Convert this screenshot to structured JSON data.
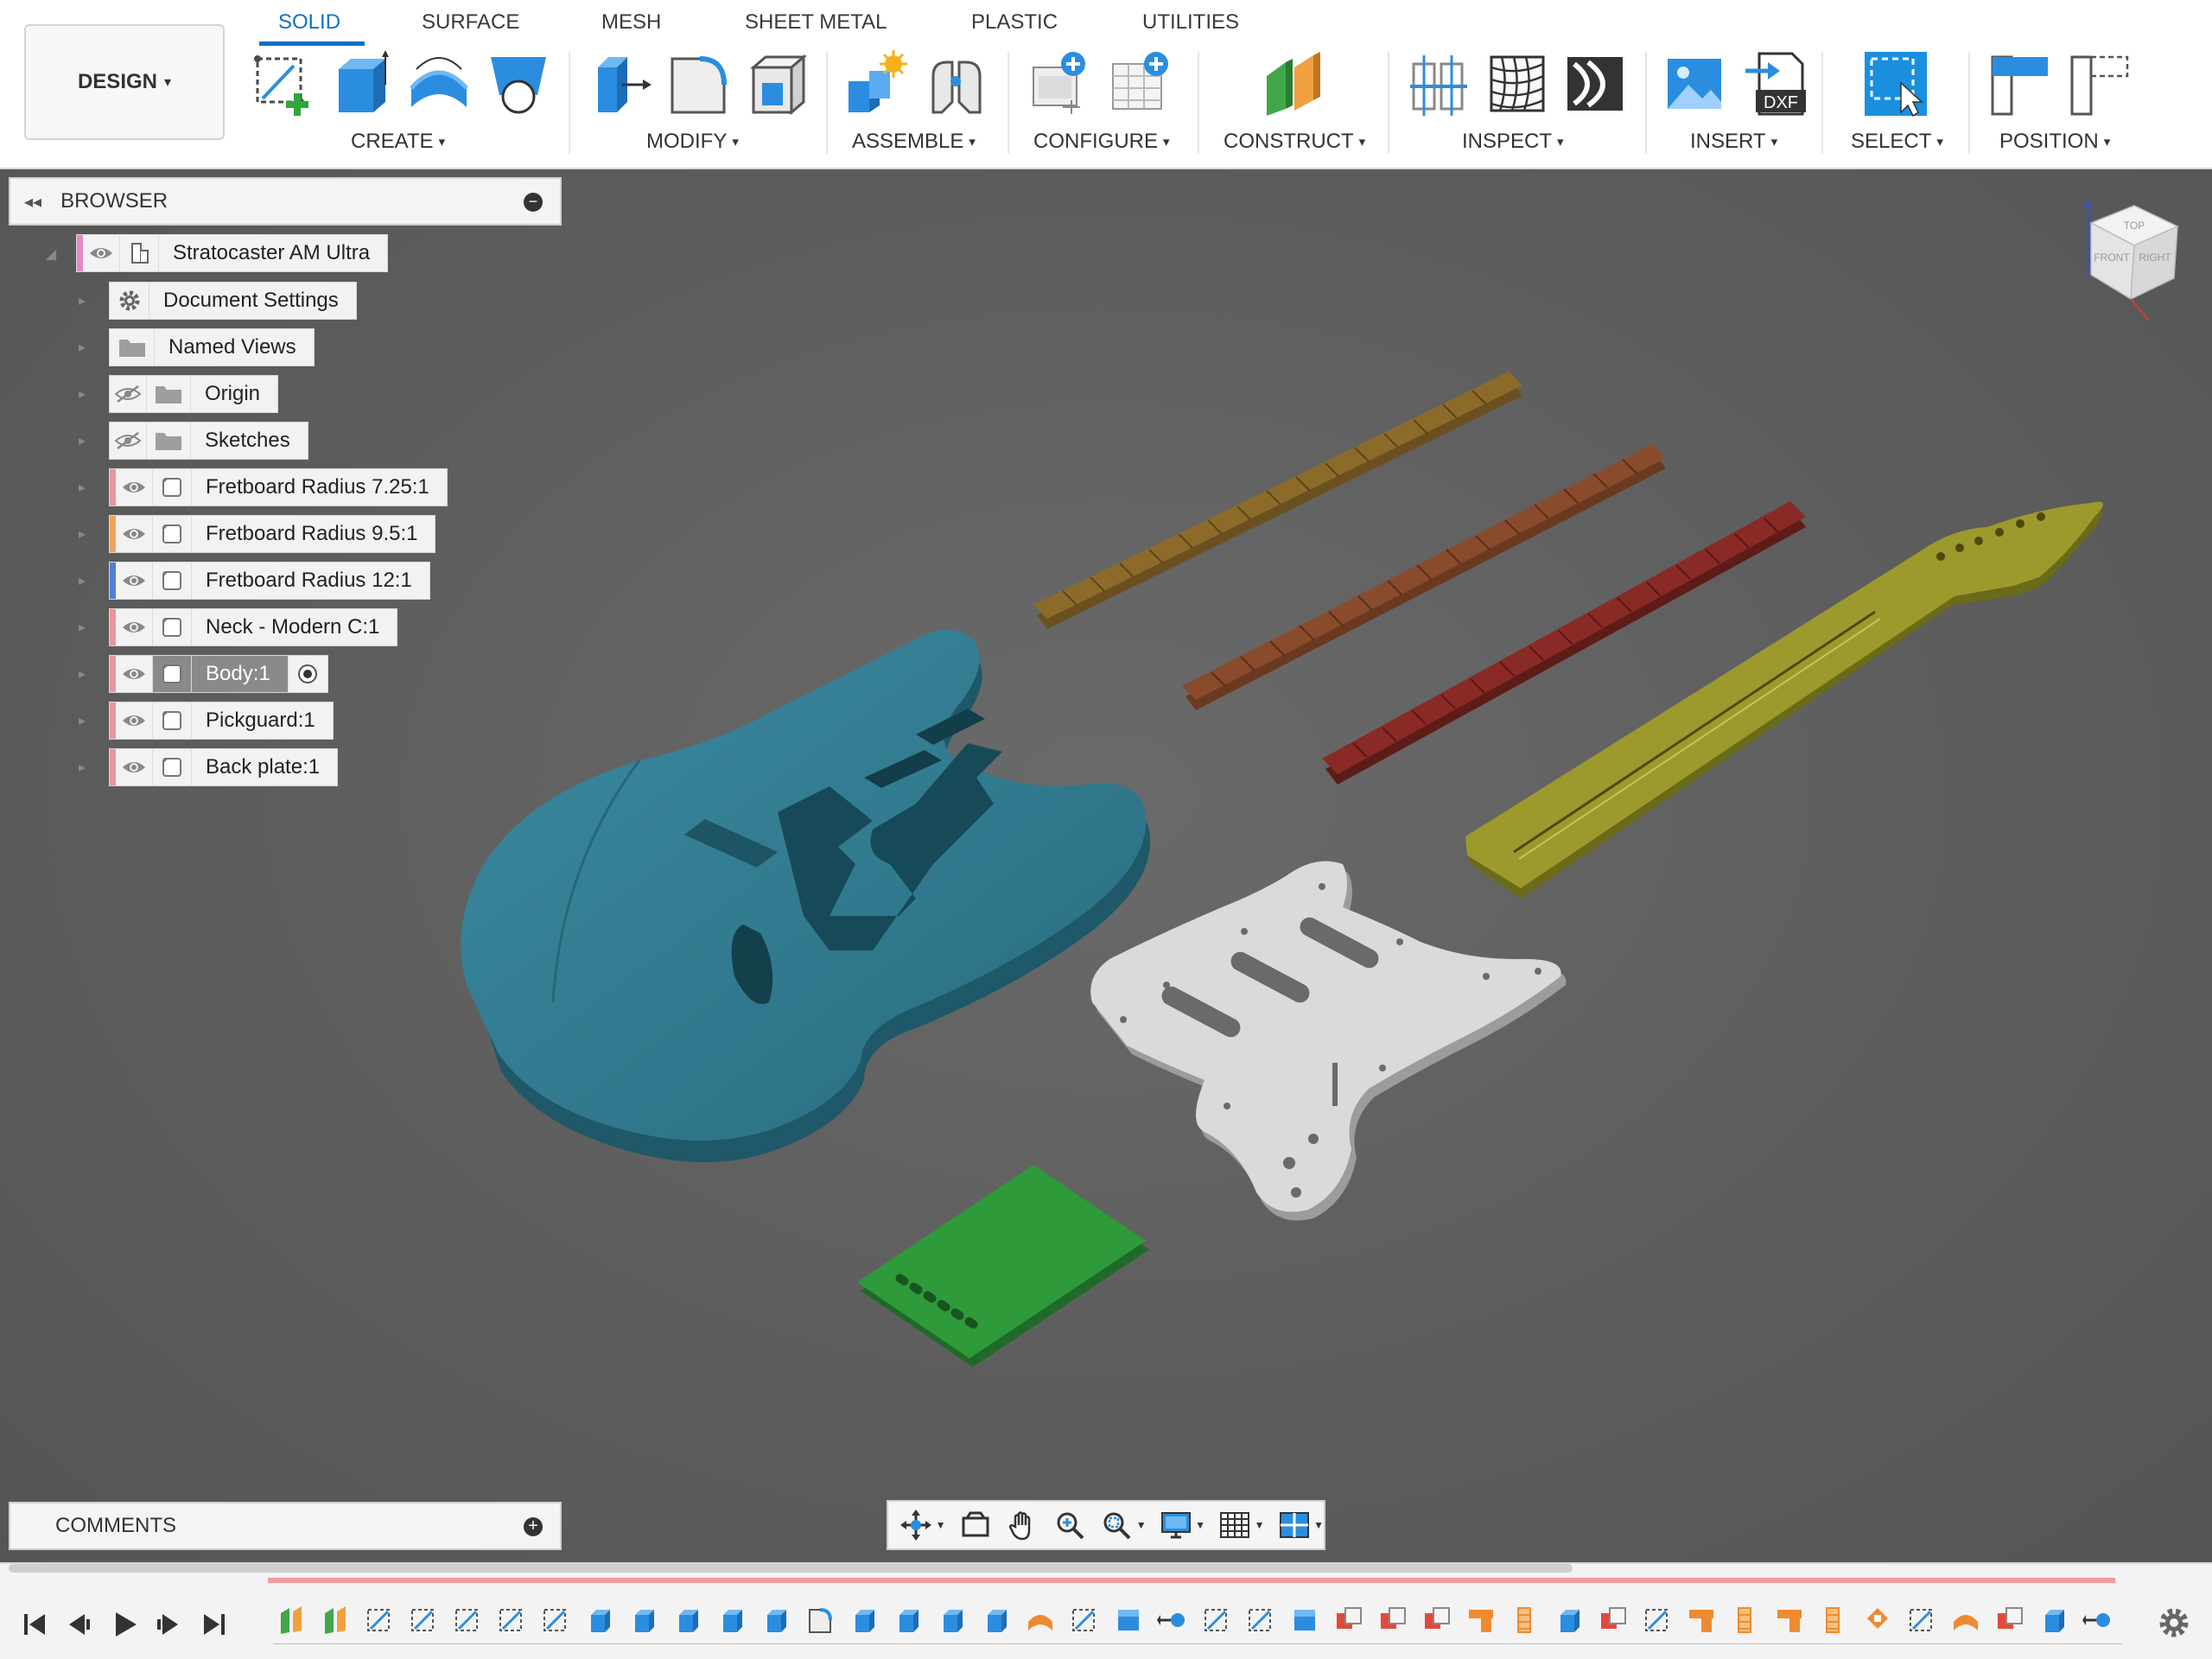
{
  "workspace": {
    "label": "DESIGN",
    "caret": "▾"
  },
  "tabs": [
    "SOLID",
    "SURFACE",
    "MESH",
    "SHEET METAL",
    "PLASTIC",
    "UTILITIES"
  ],
  "active_tab": "SOLID",
  "groups": {
    "create": "CREATE",
    "modify": "MODIFY",
    "assemble": "ASSEMBLE",
    "configure": "CONFIGURE",
    "construct": "CONSTRUCT",
    "inspect": "INSPECT",
    "insert": "INSERT",
    "select": "SELECT",
    "position": "POSITION"
  },
  "group_caret": "▾",
  "browser": {
    "title": "BROWSER",
    "collapse_icon": "◂◂",
    "minus_icon": "−",
    "root": "Stratocaster AM Ultra",
    "items": [
      {
        "label": "Document Settings",
        "icon": "gear-icon"
      },
      {
        "label": "Named Views",
        "icon": "folder-icon"
      },
      {
        "label": "Origin",
        "icon": "folder-icon",
        "hidden": true
      },
      {
        "label": "Sketches",
        "icon": "folder-icon",
        "hidden": true
      },
      {
        "label": "Fretboard Radius 7.25:1",
        "stripe": "#e8969c"
      },
      {
        "label": "Fretboard Radius 9.5:1",
        "stripe": "#f0a45c"
      },
      {
        "label": "Fretboard Radius 12:1",
        "stripe": "#4f7fd8"
      },
      {
        "label": "Neck - Modern C:1",
        "stripe": "#e8969c"
      },
      {
        "label": "Body:1",
        "stripe": "#e8969c",
        "selected": true
      },
      {
        "label": "Pickguard:1",
        "stripe": "#e8969c"
      },
      {
        "label": "Back plate:1",
        "stripe": "#e8969c"
      }
    ]
  },
  "comments": {
    "title": "COMMENTS",
    "plus_icon": "+"
  },
  "viewcube": {
    "top": "TOP",
    "front": "FRONT",
    "right": "RIGHT",
    "z_axis": "Z"
  },
  "dxf_label": "DXF",
  "colors": {
    "accent": "#0b72c9",
    "viewport": "#5f5f5f",
    "body": "#2f7488",
    "pickguard": "#d9d9d9",
    "backplate": "#2e9a3a",
    "neck": "#9c9a2c",
    "fretboard_1": "#8c6b2a",
    "fretboard_2": "#8a4b2c",
    "fretboard_3": "#8a2a26"
  }
}
